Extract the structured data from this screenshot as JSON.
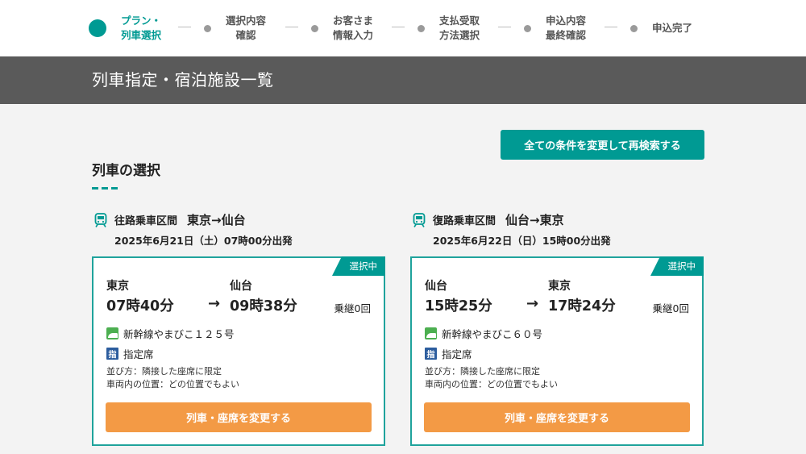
{
  "stepper": {
    "steps": [
      {
        "label": "プラン・\n列車選択",
        "active": true
      },
      {
        "label": "選択内容\n確認"
      },
      {
        "label": "お客さま\n情報入力"
      },
      {
        "label": "支払受取\n方法選択"
      },
      {
        "label": "申込内容\n最終確認"
      },
      {
        "label": "申込完了"
      }
    ]
  },
  "banner": {
    "title": "列車指定・宿泊施設一覧"
  },
  "research_button": {
    "label": "全ての条件を変更して再検索する"
  },
  "section": {
    "title": "列車の選択"
  },
  "outbound": {
    "label": "往路乗車区間",
    "route": "東京→仙台",
    "date": "2025年6月21日（土）07時00分出発",
    "badge": "選択中",
    "from_station": "東京",
    "from_time": "07時40分",
    "arrow": "→",
    "to_station": "仙台",
    "to_time": "09時38分",
    "transfer": "乗継0回",
    "train": "新幹線やまびこ１２５号",
    "seat_icon": "指",
    "seat": "指定席",
    "pref1": "並び方：隣接した座席に限定",
    "pref2": "車両内の位置：どの位置でもよい",
    "change_label": "列車・座席を変更する"
  },
  "return": {
    "label": "復路乗車区間",
    "route": "仙台→東京",
    "date": "2025年6月22日（日）15時00分出発",
    "badge": "選択中",
    "from_station": "仙台",
    "from_time": "15時25分",
    "arrow": "→",
    "to_station": "東京",
    "to_time": "17時24分",
    "transfer": "乗継0回",
    "train": "新幹線やまびこ６０号",
    "seat_icon": "指",
    "seat": "指定席",
    "pref1": "並び方：隣接した座席に限定",
    "pref2": "車両内の位置：どの位置でもよい",
    "change_label": "列車・座席を変更する"
  },
  "colors": {
    "accent": "#009a93",
    "banner": "#5a5a5a",
    "button_orange": "#f39a45",
    "seat_icon": "#2c5d9e",
    "shinkansen_icon": "#4caf50"
  },
  "icons": {
    "route": "train-icon",
    "train": "shinkansen-icon",
    "seat": "reserved-seat-icon"
  }
}
